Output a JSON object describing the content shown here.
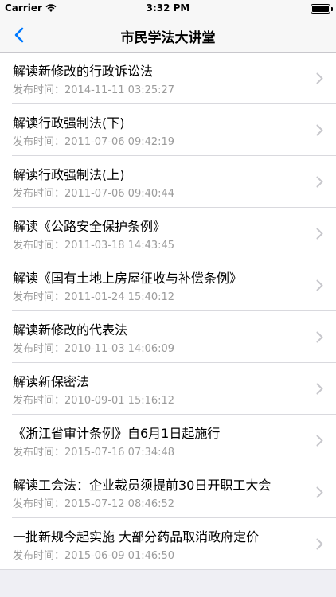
{
  "status_bar": {
    "carrier": "Carrier",
    "time": "3:32 PM"
  },
  "nav": {
    "title": "市民学法大讲堂",
    "back_icon": "chevron-left-icon",
    "accent_color": "#007aff"
  },
  "articles": [
    {
      "title": "解读新修改的行政诉讼法",
      "meta": "发布时间：2014-11-11 03:25:27"
    },
    {
      "title": "解读行政强制法(下)",
      "meta": "发布时间：2011-07-06 09:42:19"
    },
    {
      "title": "解读行政强制法(上)",
      "meta": "发布时间：2011-07-06 09:40:44"
    },
    {
      "title": "解读《公路安全保护条例》",
      "meta": "发布时间：2011-03-18 14:43:45"
    },
    {
      "title": "解读《国有土地上房屋征收与补偿条例》",
      "meta": "发布时间：2011-01-24 15:40:12"
    },
    {
      "title": "解读新修改的代表法",
      "meta": "发布时间：2010-11-03 14:06:09"
    },
    {
      "title": "解读新保密法",
      "meta": "发布时间：2010-09-01 15:16:12"
    },
    {
      "title": "《浙江省审计条例》自6月1日起施行",
      "meta": "发布时间：2015-07-16 07:34:48"
    },
    {
      "title": "解读工会法：企业裁员须提前30日开职工大会",
      "meta": "发布时间：2015-07-12 08:46:52"
    },
    {
      "title": "一批新规今起实施 大部分药品取消政府定价",
      "meta": "发布时间：2015-06-09 01:46:50"
    }
  ]
}
